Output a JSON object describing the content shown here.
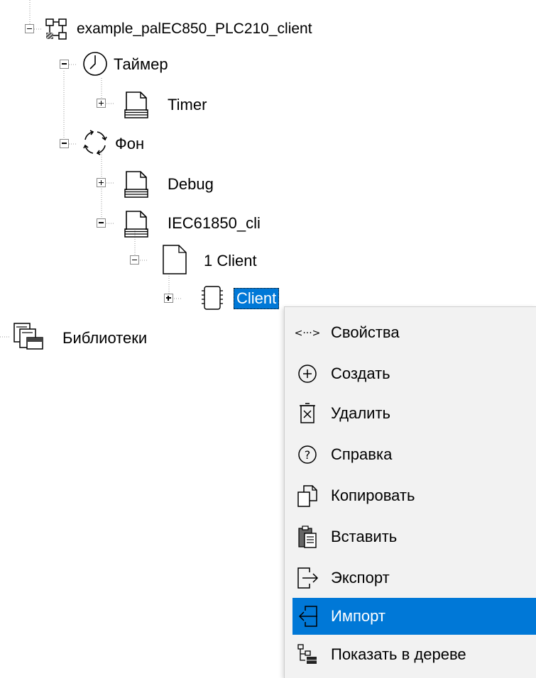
{
  "tree": {
    "root": {
      "label": "example_palEC850_PLC210_client"
    },
    "timer_group": {
      "label": "Таймер"
    },
    "timer_task": {
      "label": "Timer"
    },
    "background_group": {
      "label": "Фон"
    },
    "debug_task": {
      "label": "Debug"
    },
    "iec_task": {
      "label": "IEC61850_cli"
    },
    "client_program": {
      "label": "1 Client"
    },
    "client_block": {
      "label": "Client"
    },
    "libraries": {
      "label": "Библиотеки"
    }
  },
  "context_menu": {
    "items": [
      {
        "label": "Свойства",
        "icon": "properties-icon"
      },
      {
        "label": "Создать",
        "icon": "create-icon"
      },
      {
        "label": "Удалить",
        "icon": "delete-icon"
      },
      {
        "label": "Справка",
        "icon": "help-icon"
      },
      {
        "label": "Копировать",
        "icon": "copy-icon"
      },
      {
        "label": "Вставить",
        "icon": "paste-icon"
      },
      {
        "label": "Экспорт",
        "icon": "export-icon"
      },
      {
        "label": "Импорт",
        "icon": "import-icon"
      },
      {
        "label": "Показать в дереве",
        "icon": "show-in-tree-icon"
      }
    ],
    "highlighted": "Импорт"
  },
  "colors": {
    "selection": "#0078d7",
    "menu_background": "#f2f2f2"
  }
}
